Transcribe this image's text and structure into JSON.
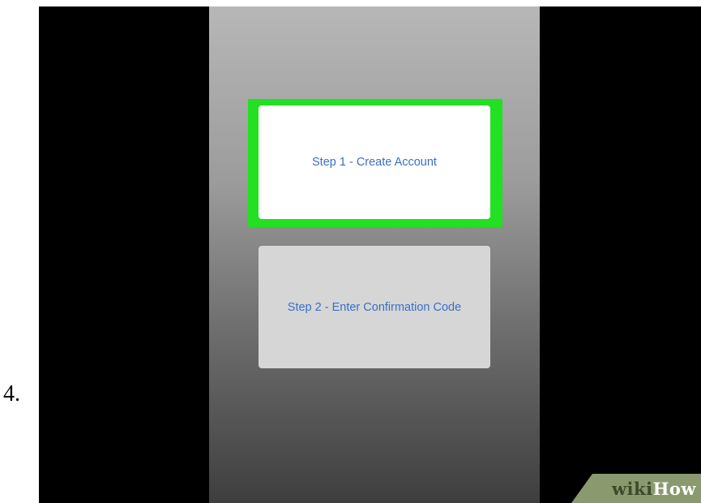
{
  "step_number": "4.",
  "screen": {
    "create_account_label": "Step 1 - Create Account",
    "confirmation_code_label": "Step 2 - Enter Confirmation Code",
    "highlight_color": "#22e022",
    "button_text_color": "#3a6fc7"
  },
  "watermark": {
    "wiki": "wiki",
    "how": "How"
  }
}
